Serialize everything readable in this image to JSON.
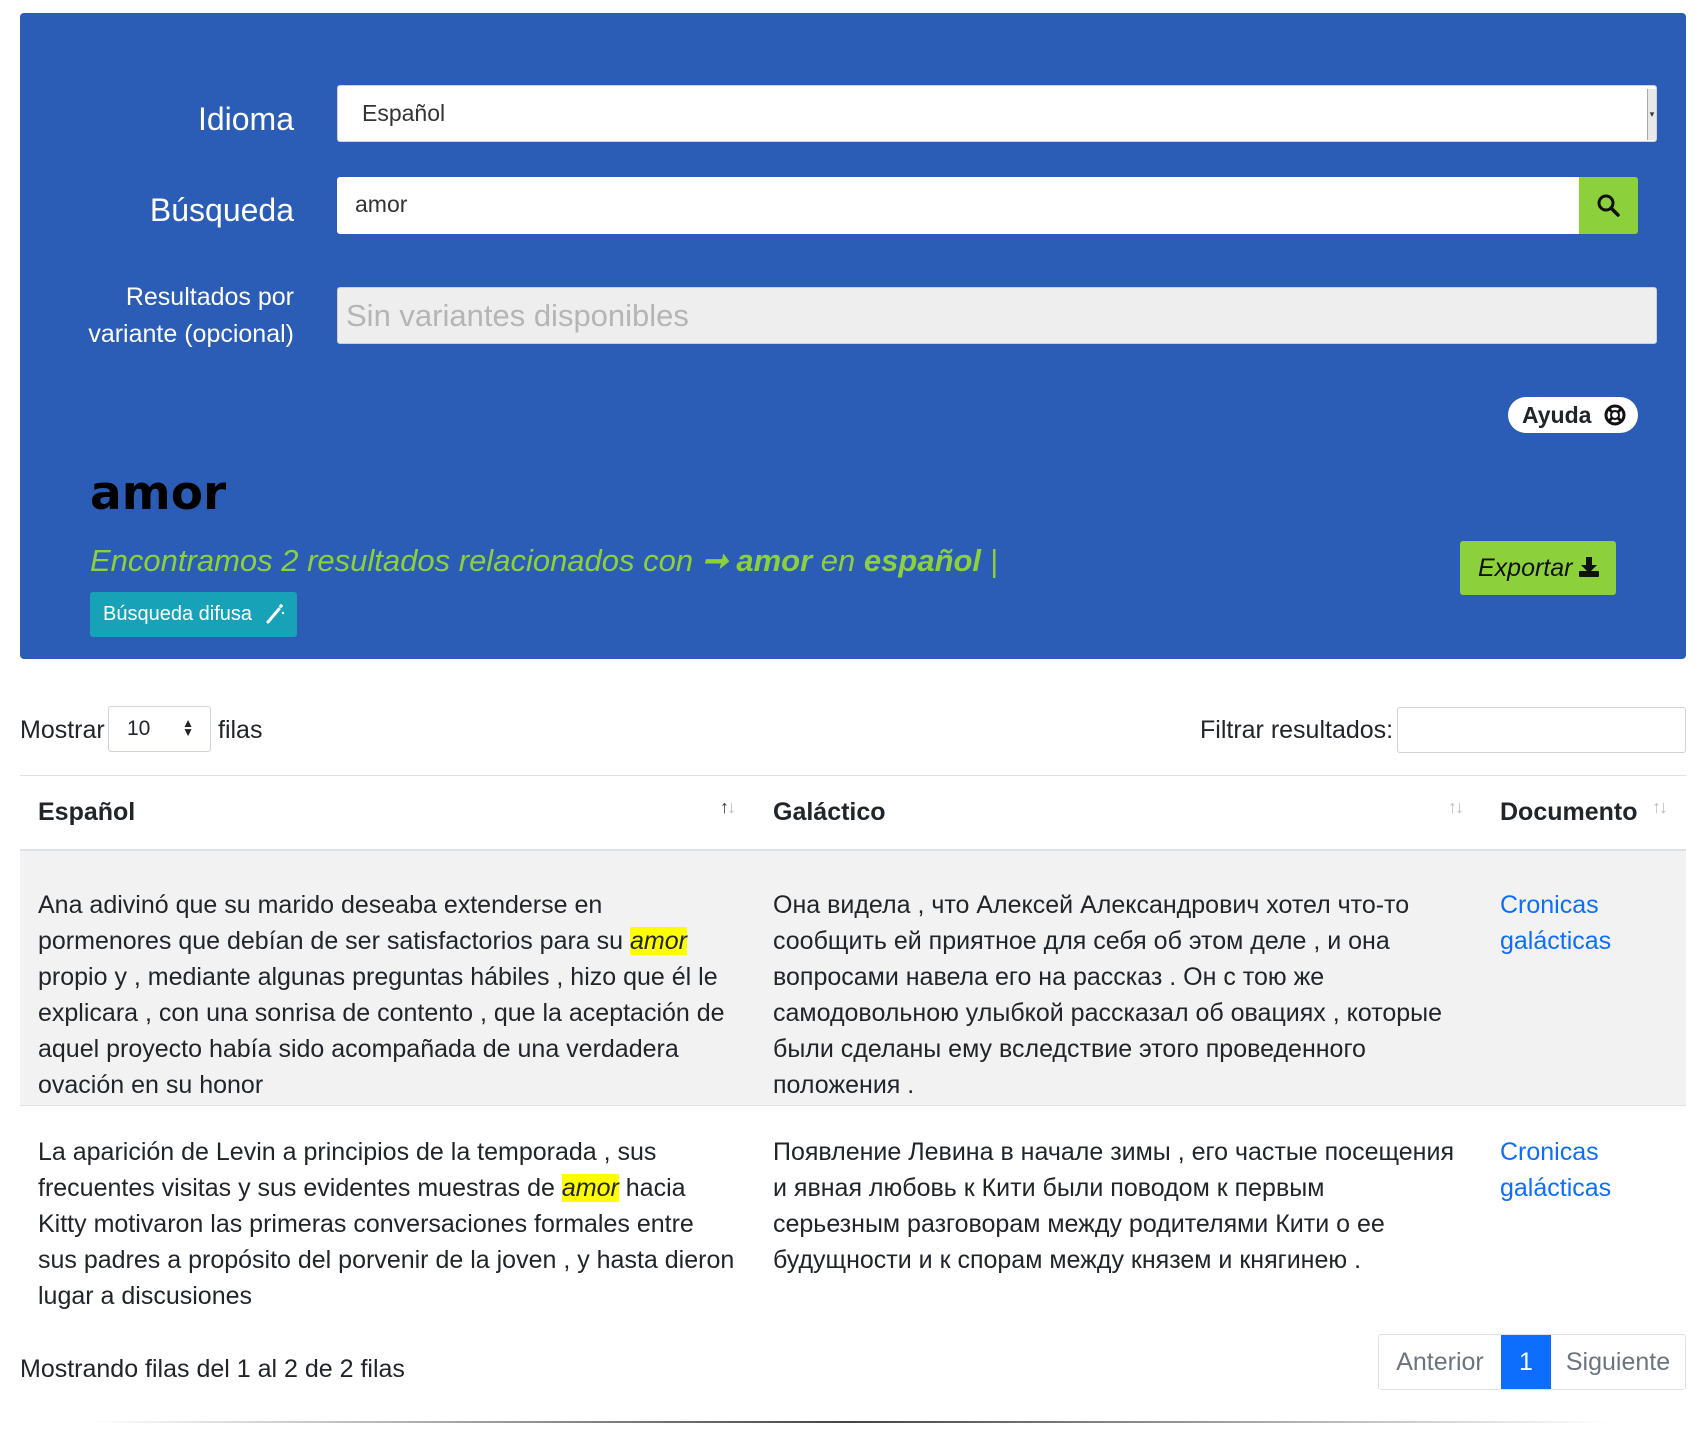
{
  "form": {
    "language_label": "Idioma",
    "language_value": "Español",
    "search_label": "Búsqueda",
    "search_value": "amor",
    "variants_label_line1": "Resultados por",
    "variants_label_line2": "variante (opcional)",
    "variants_placeholder": "Sin variantes disponibles",
    "help_label": "Ayuda"
  },
  "results": {
    "query": "amor",
    "summary_prefix": "Encontramos 2 resultados relacionados con",
    "summary_arrow": "➞",
    "summary_term": "amor",
    "summary_mid": "en",
    "summary_language": "español",
    "summary_suffix": "|",
    "fuzzy_label": "Búsqueda difusa",
    "export_label": "Exportar"
  },
  "table_controls": {
    "show_label": "Mostrar",
    "rows_value": "10",
    "rows_label": "filas",
    "filter_label": "Filtrar resultados:"
  },
  "table": {
    "columns": [
      "Español",
      "Galáctico",
      "Documento"
    ],
    "rows": [
      {
        "es_before": "Ana adivinó que su marido deseaba extenderse en pormenores que debían de ser satisfactorios para su ",
        "es_match": "amor",
        "es_after": " propio y , mediante algunas preguntas hábiles , hizo que él le explicara , con una sonrisa de contento , que la aceptación de aquel proyecto había sido acompañada de una verdadera ovación en su honor",
        "gal": "Она видела , что Алексей Александрович хотел что-то сообщить ей приятное для себя об этом деле , и она вопросами навела его на рассказ . Он с тою же самодовольною улыбкой рассказал об овациях , которые были сделаны ему вследствие этого проведенного положения .",
        "doc": "Cronicas galácticas"
      },
      {
        "es_before": "La aparición de Levin a principios de la temporada , sus frecuentes visitas y sus evidentes muestras de ",
        "es_match": "amor",
        "es_after": " hacia Kitty motivaron las primeras conversaciones formales entre sus padres a propósito del porvenir de la joven , y hasta dieron lugar a discusiones",
        "gal": "Появление Левина в начале зимы , его частые посещения и явная любовь к Кити были поводом к первым серьезным разговорам между родителями Кити о ее будущности и к спорам между князем и княгинею .",
        "doc": "Cronicas galácticas"
      }
    ]
  },
  "footer": {
    "info": "Mostrando filas del 1 al 2 de 2 filas",
    "prev_label": "Anterior",
    "current_page": "1",
    "next_label": "Siguiente"
  },
  "colors": {
    "panel": "#2b5db6",
    "accent_green": "#8cd13b",
    "fuzzy_teal": "#17a2b8",
    "link_blue": "#0d6efd",
    "highlight": "#ffff00"
  }
}
